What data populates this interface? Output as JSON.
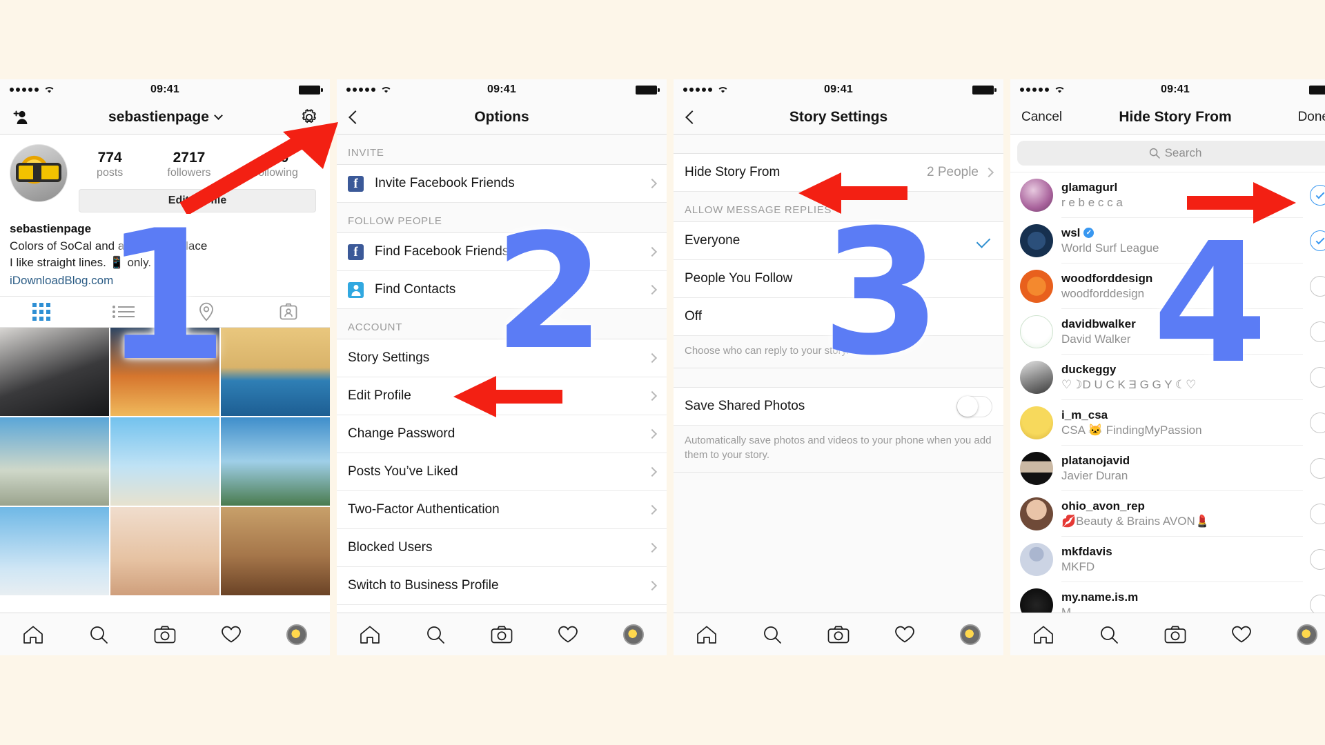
{
  "meta": {
    "status_time": "09:41",
    "accent_blue": "#5b7cf5",
    "arrow_red": "#f32013",
    "link_blue": "#2b5c85"
  },
  "steps": [
    "1",
    "2",
    "3",
    "4"
  ],
  "panel_profile": {
    "nav": {
      "title": "sebastienpage",
      "add_user_icon": "add-person-icon",
      "gear_icon": "gear-icon"
    },
    "stats": [
      {
        "value": "774",
        "label": "posts"
      },
      {
        "value": "2717",
        "label": "followers"
      },
      {
        "value": "200",
        "label": "following"
      }
    ],
    "edit_profile_label": "Edit Profile",
    "bio": {
      "name": "sebastienpage",
      "line1": "Colors of SoCal and a few other place",
      "line2": "I like straight lines. 📱 only.",
      "link": "iDownloadBlog.com"
    },
    "tabs": [
      "grid-icon",
      "list-icon",
      "location-icon",
      "tagged-icon"
    ]
  },
  "panel_options": {
    "nav": {
      "back": "back-chevron-icon",
      "title": "Options"
    },
    "sections": [
      {
        "header": "INVITE",
        "items": [
          {
            "label": "Invite Facebook Friends",
            "icon": "facebook-icon"
          }
        ]
      },
      {
        "header": "FOLLOW PEOPLE",
        "items": [
          {
            "label": "Find Facebook Friends",
            "icon": "facebook-icon"
          },
          {
            "label": "Find Contacts",
            "icon": "contacts-icon"
          }
        ]
      },
      {
        "header": "ACCOUNT",
        "items": [
          {
            "label": "Story Settings",
            "icon": ""
          },
          {
            "label": "Edit Profile",
            "icon": ""
          },
          {
            "label": "Change Password",
            "icon": ""
          },
          {
            "label": "Posts You’ve Liked",
            "icon": ""
          },
          {
            "label": "Two-Factor Authentication",
            "icon": ""
          },
          {
            "label": "Blocked Users",
            "icon": ""
          },
          {
            "label": "Switch to Business Profile",
            "icon": ""
          }
        ]
      }
    ]
  },
  "panel_story_settings": {
    "nav": {
      "back": "back-chevron-icon",
      "title": "Story Settings"
    },
    "hide_story": {
      "label": "Hide Story From",
      "value": "2 People"
    },
    "replies_header": "ALLOW MESSAGE REPLIES",
    "replies_options": [
      {
        "label": "Everyone",
        "selected": true
      },
      {
        "label": "People You Follow",
        "selected": false
      },
      {
        "label": "Off",
        "selected": false
      }
    ],
    "replies_footnote": "Choose who can reply to your story.",
    "save_photos": {
      "label": "Save Shared Photos",
      "on": false
    },
    "save_photos_footnote": "Automatically save photos and videos to your phone when you add them to your story."
  },
  "panel_hide_story": {
    "nav": {
      "cancel": "Cancel",
      "title": "Hide Story From",
      "done": "Done"
    },
    "search_placeholder": "Search",
    "users": [
      {
        "username": "glamagurl",
        "fullname": "r e b e c c a",
        "selected": true,
        "verified": false,
        "avatar": "#b98cb0"
      },
      {
        "username": "wsl",
        "fullname": "World Surf League",
        "selected": true,
        "verified": true,
        "avatar": "#1c2f4a"
      },
      {
        "username": "woodforddesign",
        "fullname": "woodforddesign",
        "selected": false,
        "verified": false,
        "avatar": "#ef6a1d"
      },
      {
        "username": "davidbwalker",
        "fullname": "David Walker",
        "selected": false,
        "verified": false,
        "avatar": "#f4f8f4"
      },
      {
        "username": "duckeggy",
        "fullname": "♡☽D U C K Ǝ G G Y ☾♡",
        "selected": false,
        "verified": false,
        "avatar": "#9a9a9a"
      },
      {
        "username": "i_m_csa",
        "fullname": "CSA 🐱 FindingMyPassion",
        "selected": false,
        "verified": false,
        "avatar": "#e8c84b"
      },
      {
        "username": "platanojavid",
        "fullname": "Javier  Duran",
        "selected": false,
        "verified": false,
        "avatar": "#1a1a1a"
      },
      {
        "username": "ohio_avon_rep",
        "fullname": "💋Beauty & Brains AVON💄",
        "selected": false,
        "verified": false,
        "avatar": "#8d6a58"
      },
      {
        "username": "mkfdavis",
        "fullname": "MKFD",
        "selected": false,
        "verified": false,
        "avatar": "#ccd4e4"
      },
      {
        "username": "my.name.is.m",
        "fullname": "M",
        "selected": false,
        "verified": false,
        "avatar": "#0d0d0d"
      }
    ]
  },
  "tabbar": [
    "home-icon",
    "search-icon",
    "camera-icon",
    "heart-icon",
    "profile-avatar-icon"
  ]
}
